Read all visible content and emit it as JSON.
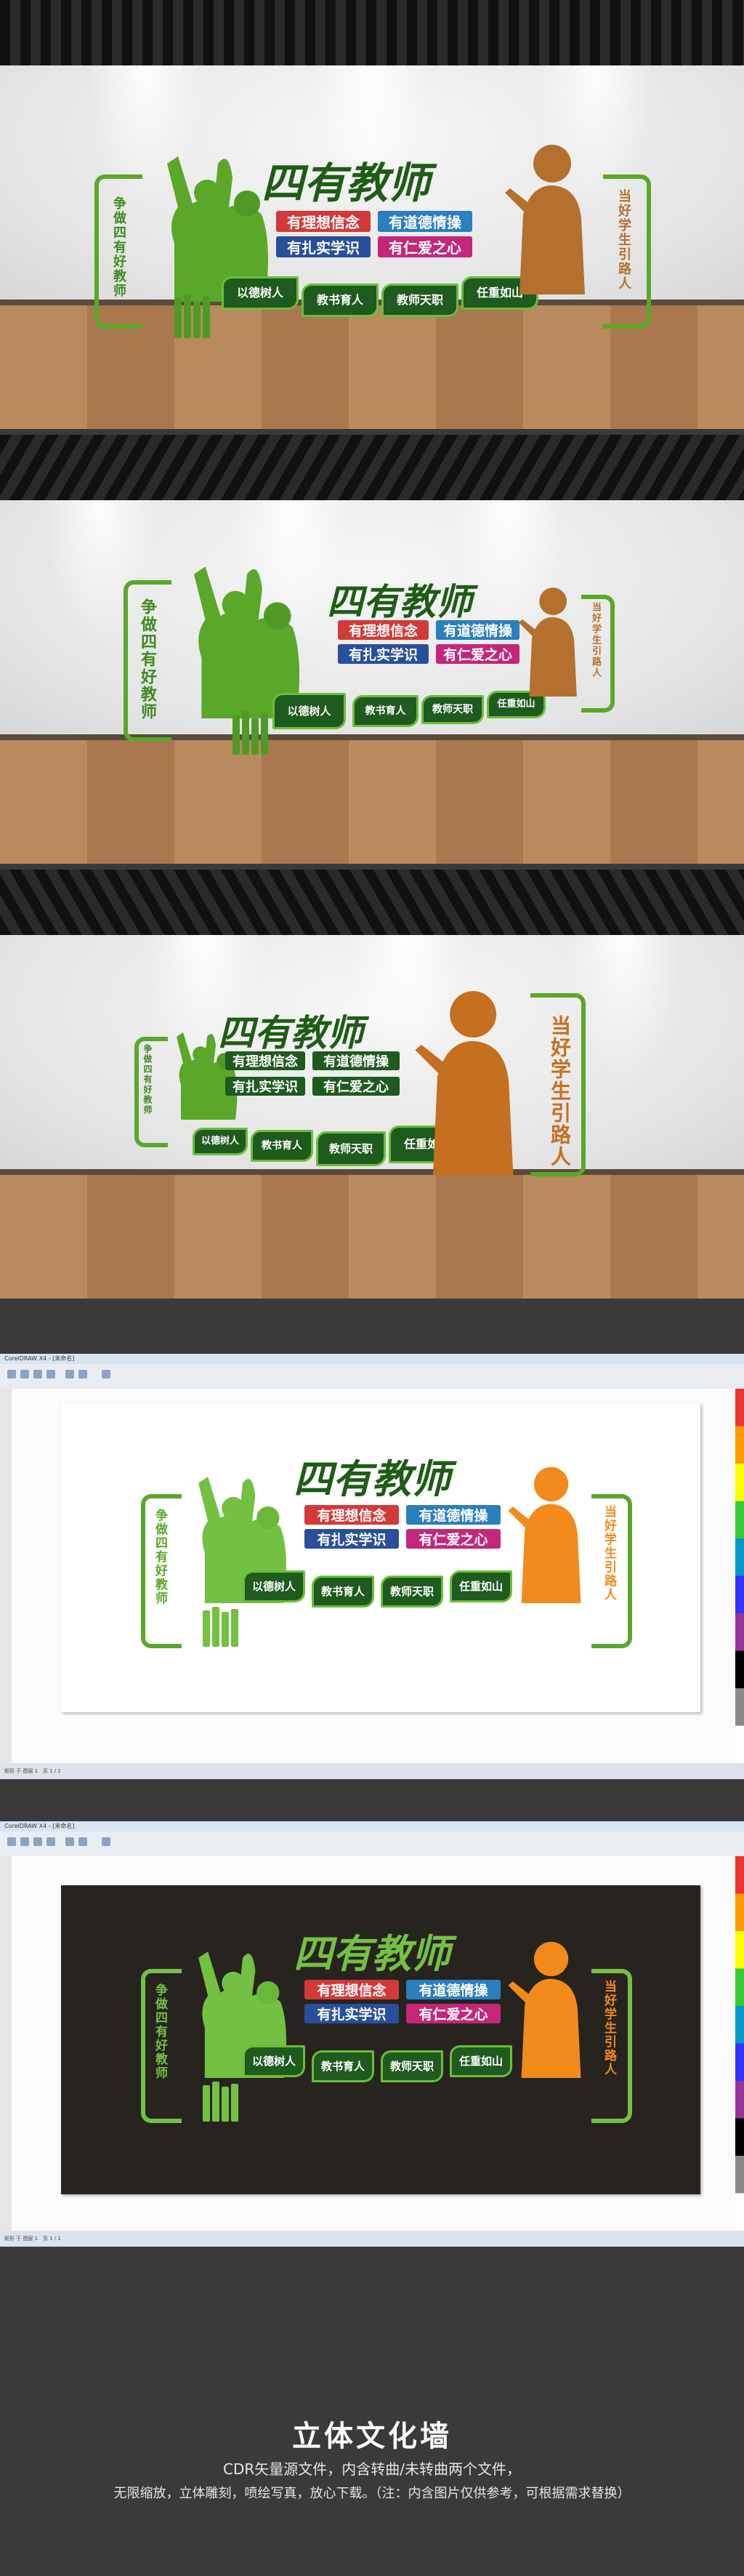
{
  "mural": {
    "title": "四有教师",
    "left_vertical": "争做四有好教师",
    "right_vertical": "当好学生引路人",
    "tags": [
      {
        "label": "有理想信念",
        "color": "#d23a3a"
      },
      {
        "label": "有道德情操",
        "color": "#2a7fbd"
      },
      {
        "label": "有扎实学识",
        "color": "#2a4f9a"
      },
      {
        "label": "有仁爱之心",
        "color": "#c4267a"
      }
    ],
    "pills": [
      "以德树人",
      "教书育人",
      "教师天职",
      "任重如山"
    ],
    "colors": {
      "green": "#5aa72a",
      "dark_green": "#1f5a1f",
      "orange": "#e07a18",
      "teacher_render": "#b4702e"
    }
  },
  "app": {
    "window_title": "CorelDRAW X4 - [未命名]",
    "status_text": "矩形 于 图层 1",
    "bottom_status": "页 1 / 1"
  },
  "footer": {
    "heading": "立体文化墙",
    "line1": "CDR矢量源文件，内含转曲/未转曲两个文件，",
    "line2": "无限缩放，立体雕刻，喷绘写真，放心下载。（注：内含图片仅供参考，可根据需求替换）"
  }
}
